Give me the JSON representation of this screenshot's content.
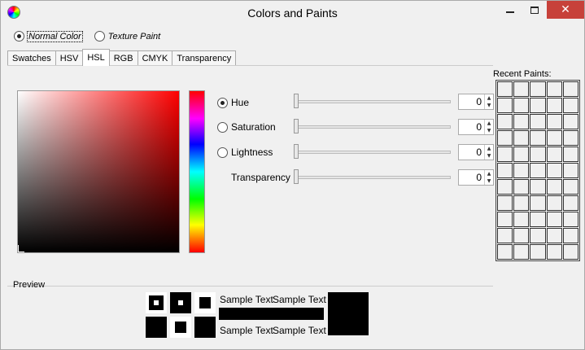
{
  "window": {
    "title": "Colors and Paints",
    "close_glyph": "✕"
  },
  "mode": {
    "options": [
      {
        "label": "Normal Color",
        "selected": true
      },
      {
        "label": "Texture Paint",
        "selected": false
      }
    ]
  },
  "tabs": [
    {
      "label": "Swatches",
      "active": false
    },
    {
      "label": "HSV",
      "active": false
    },
    {
      "label": "HSL",
      "active": true
    },
    {
      "label": "RGB",
      "active": false
    },
    {
      "label": "CMYK",
      "active": false
    },
    {
      "label": "Transparency",
      "active": false
    }
  ],
  "channels": [
    {
      "label": "Hue",
      "value": "0",
      "selected": true,
      "radio": true
    },
    {
      "label": "Saturation",
      "value": "0",
      "selected": false,
      "radio": true
    },
    {
      "label": "Lightness",
      "value": "0",
      "selected": false,
      "radio": true
    },
    {
      "label": "Transparency",
      "value": "0",
      "selected": false,
      "radio": false
    }
  ],
  "recent": {
    "title": "Recent Paints:"
  },
  "preview": {
    "label": "Preview",
    "sample_text": "Sample Text"
  },
  "colors": {
    "close_bg": "#c7413a",
    "current_color": "#000000"
  },
  "icons": {
    "app": "color-wheel-icon",
    "minimize": "minimize-icon",
    "maximize": "maximize-icon",
    "close": "close-icon"
  }
}
